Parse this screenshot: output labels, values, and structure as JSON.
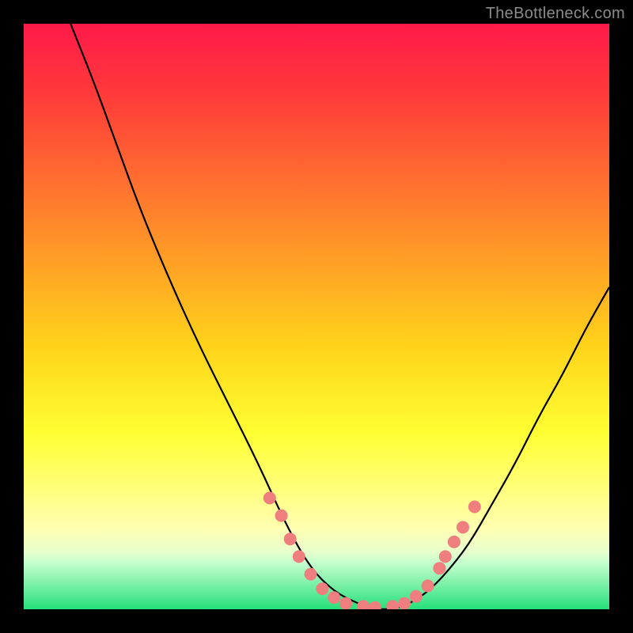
{
  "watermark": "TheBottleneck.com",
  "chart_data": {
    "type": "line",
    "title": "",
    "xlabel": "",
    "ylabel": "",
    "xlim": [
      0,
      100
    ],
    "ylim": [
      0,
      100
    ],
    "gradient_stops": [
      {
        "offset": 0.0,
        "color": "#ff1a4a"
      },
      {
        "offset": 0.12,
        "color": "#ff3a3a"
      },
      {
        "offset": 0.35,
        "color": "#ff8b2a"
      },
      {
        "offset": 0.55,
        "color": "#ffd31a"
      },
      {
        "offset": 0.7,
        "color": "#ffff33"
      },
      {
        "offset": 0.8,
        "color": "#ffff80"
      },
      {
        "offset": 0.86,
        "color": "#ffffb0"
      },
      {
        "offset": 0.9,
        "color": "#eaffcc"
      },
      {
        "offset": 0.92,
        "color": "#c6ffce"
      },
      {
        "offset": 1.0,
        "color": "#26e07a"
      }
    ],
    "series": [
      {
        "name": "bottleneck-curve",
        "color": "#000000",
        "x": [
          8,
          12,
          16,
          20,
          25,
          30,
          35,
          40,
          45,
          49,
          53,
          57,
          60,
          63,
          66,
          69,
          72,
          76,
          80,
          84,
          88,
          92,
          96,
          100
        ],
        "y": [
          100,
          90,
          79,
          68,
          56,
          45,
          35,
          25,
          14,
          7,
          3,
          1,
          0,
          0,
          1,
          3,
          6,
          11,
          18,
          25,
          33,
          40,
          48,
          55
        ]
      }
    ],
    "markers": {
      "name": "highlight-points",
      "color": "#ef7f7f",
      "radius": 8,
      "points": [
        {
          "x": 42,
          "y": 19
        },
        {
          "x": 44,
          "y": 16
        },
        {
          "x": 45.5,
          "y": 12
        },
        {
          "x": 47,
          "y": 9
        },
        {
          "x": 49,
          "y": 6
        },
        {
          "x": 51,
          "y": 3.5
        },
        {
          "x": 53,
          "y": 2
        },
        {
          "x": 55,
          "y": 1
        },
        {
          "x": 58,
          "y": 0.5
        },
        {
          "x": 60,
          "y": 0.3
        },
        {
          "x": 63,
          "y": 0.5
        },
        {
          "x": 65,
          "y": 1
        },
        {
          "x": 67,
          "y": 2.2
        },
        {
          "x": 69,
          "y": 4
        },
        {
          "x": 71,
          "y": 7
        },
        {
          "x": 72,
          "y": 9
        },
        {
          "x": 73.5,
          "y": 11.5
        },
        {
          "x": 75,
          "y": 14
        },
        {
          "x": 77,
          "y": 17.5
        }
      ]
    }
  }
}
